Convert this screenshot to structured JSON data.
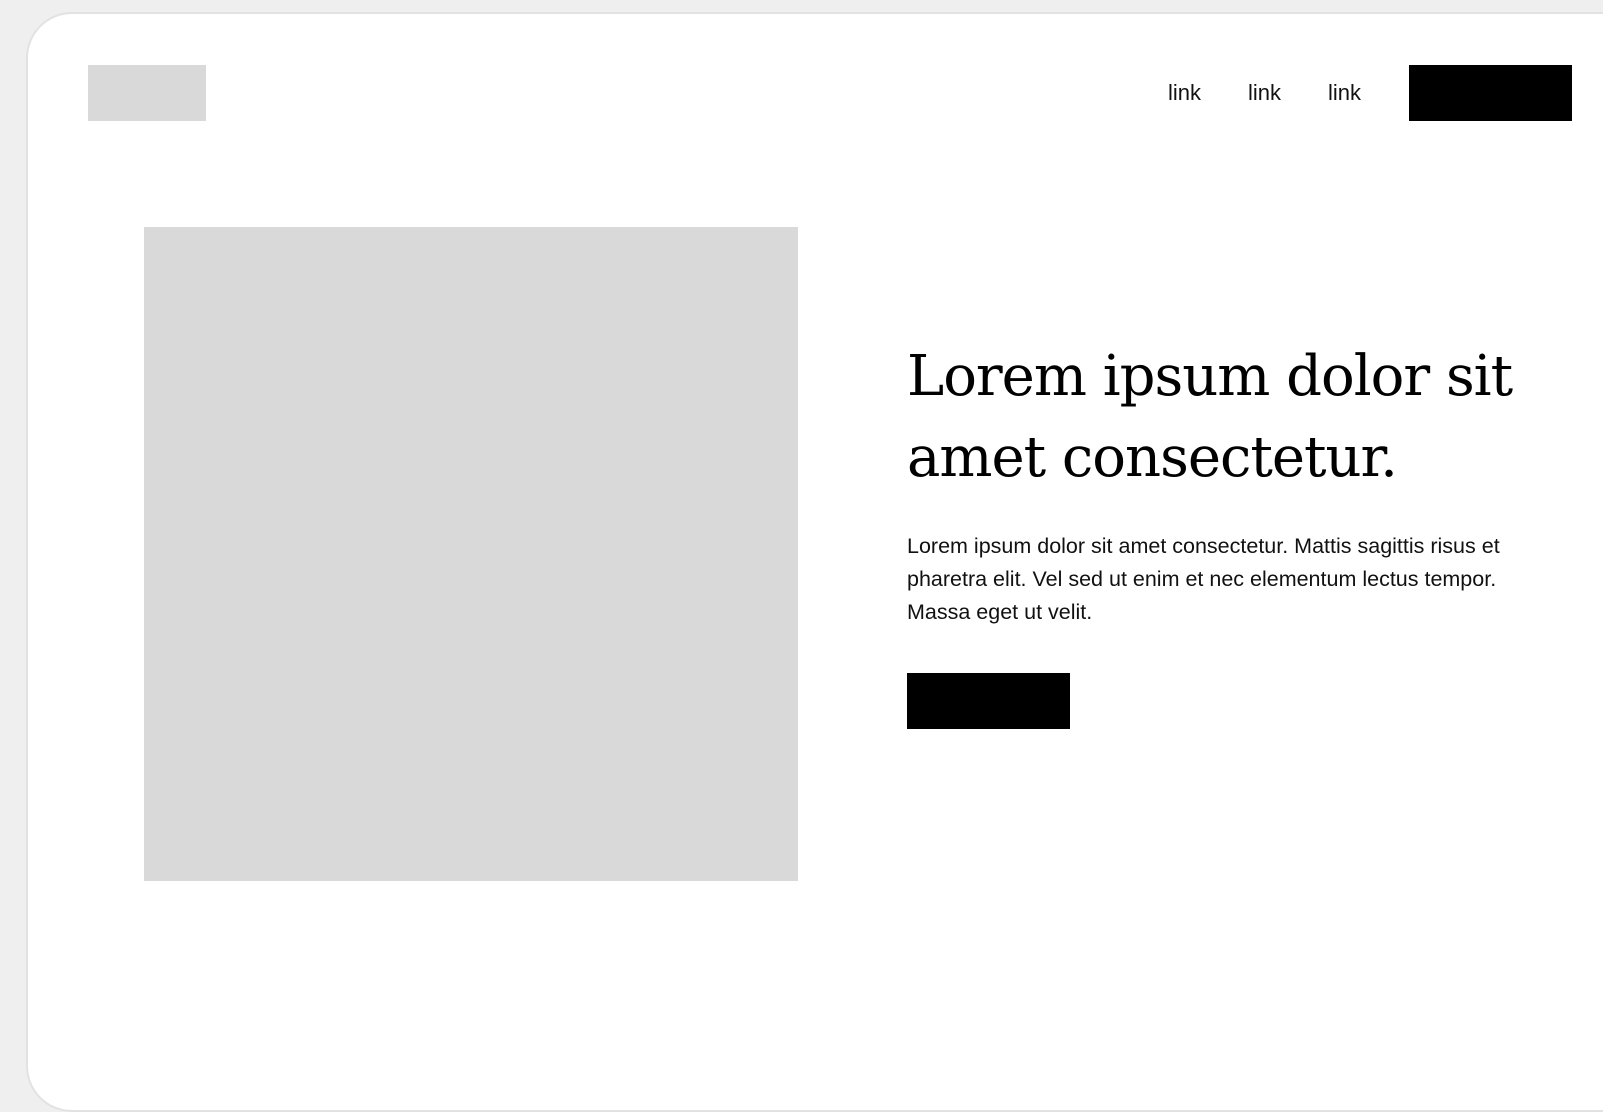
{
  "header": {
    "nav_links": [
      "link",
      "link",
      "link"
    ]
  },
  "hero": {
    "title": "Lorem ipsum dolor sit amet consectetur.",
    "body": "Lorem ipsum dolor sit amet consectetur. Mattis sagittis risus et pharetra elit. Vel sed ut enim et nec elementum lectus tempor. Massa eget ut velit."
  },
  "colors": {
    "placeholder_gray": "#d9d9d9",
    "button_black": "#000000",
    "page_background": "#efefef",
    "card_background": "#ffffff"
  }
}
